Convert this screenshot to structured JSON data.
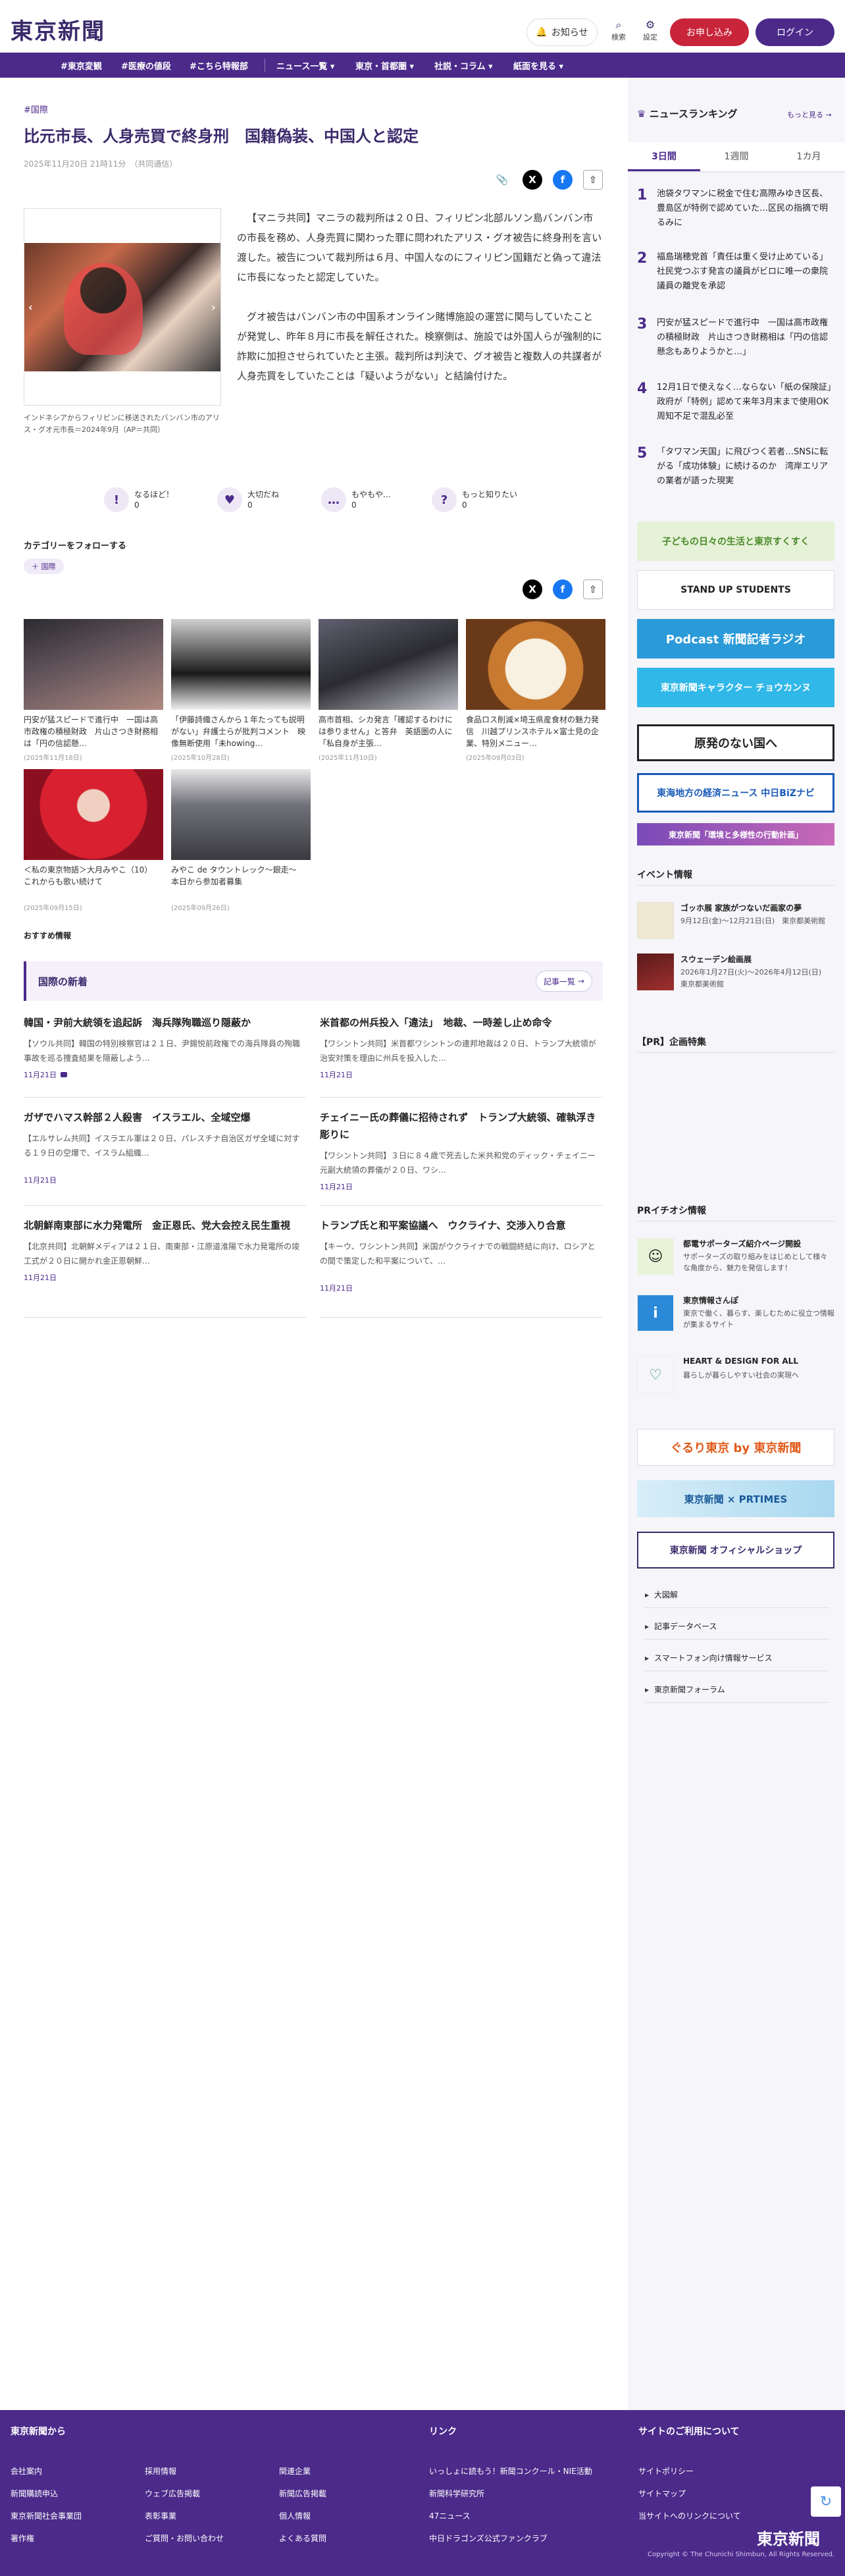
{
  "header": {
    "logo": "東京新聞",
    "notice": "お知らせ",
    "search": "検索",
    "settings": "設定",
    "subscribe": "お申し込み",
    "login": "ログイン"
  },
  "nav": [
    "#東京変観",
    "#医療の値段",
    "#こちら特報部",
    "ニュース一覧",
    "東京・首都圏",
    "社説・コラム",
    "紙面を見る"
  ],
  "article": {
    "category": "#国際",
    "title": "比元市長、人身売買で終身刑　国籍偽装、中国人と認定",
    "date": "2025年11月20日 21時11分　（共同通信）",
    "caption": "インドネシアからフィリピンに移送されたバンバン市のアリス・グオ元市長＝2024年9月（AP＝共同）",
    "paragraphs": [
      "【マニラ共同】マニラの裁判所は２０日、フィリピン北部ルソン島バンバン市の市長を務め、人身売買に関わった罪に問われたアリス・グオ被告に終身刑を言い渡した。被告について裁判所は６月、中国人なのにフィリピン国籍だと偽って違法に市長になったと認定していた。",
      "グオ被告はバンバン市の中国系オンライン賭博施設の運営に関与していたことが発覚し、昨年８月に市長を解任された。検察側は、施設では外国人らが強制的に詐欺に加担させられていたと主張。裁判所は判決で、グオ被告と複数人の共謀者が人身売買をしていたことは「疑いようがない」と結論付けた。"
    ],
    "reactions": [
      {
        "icon": "!",
        "label": "なるほど！",
        "count": "0"
      },
      {
        "icon": "♥",
        "label": "大切だね",
        "count": "0"
      },
      {
        "icon": "…",
        "label": "もやもや…",
        "count": "0"
      },
      {
        "icon": "?",
        "label": "もっと知りたい",
        "count": "0"
      }
    ],
    "follow_label": "カテゴリーをフォローする",
    "follow_tag": "国際"
  },
  "related": [
    {
      "title": "円安が猛スピードで進行中　一国は高市政権の積極財政　片山さつき財務相は「円の信認懸…",
      "date": "(2025年11月18日)",
      "color": "#3a3a40"
    },
    {
      "title": "「伊藤詩織さんから１年たっても説明がない」弁護士らが批判コメント　映像無断使用「未howing…",
      "date": "(2025年10月28日)",
      "color": "#2a2a2a"
    },
    {
      "title": "高市首相、シカ発言「確認するわけには参りません」と答弁　英語圏の人に「私自身が主張…",
      "date": "(2025年11月10日)",
      "color": "#4a4a50"
    },
    {
      "title": "食品ロス削減×埼玉県産食材の魅力発信　川越プリンスホテル×富士見の企業、特別メニュー…",
      "date": "(2025年09月03日)",
      "color": "#8a5a20"
    },
    {
      "title": "＜私の東京物語＞大月みやこ（10）　これからも歌い続けて",
      "date": "(2025年09月15日)",
      "color": "#c8243a"
    },
    {
      "title": "みやこ de タウントレック〜銀走〜　本日から参加者募集",
      "date": "(2025年09月26日)",
      "color": "#555"
    }
  ],
  "recommend_label": "おすすめ情報",
  "intl": {
    "heading": "国際の新着",
    "more": "記事一覧",
    "items": [
      {
        "title": "韓国・尹前大統領を追起訴　海兵隊殉職巡り隠蔽か",
        "summary": "【ソウル共同】韓国の特別検察官は２１日、尹錫悦前政権での海兵隊員の殉職事故を巡る捜査結果を隠蔽しよう…",
        "date": "11月21日"
      },
      {
        "title": "米首都の州兵投入「違法」　地裁、一時差し止め命令",
        "summary": "【ワシントン共同】米首都ワシントンの連邦地裁は２０日、トランプ大統領が治安対策を理由に州兵を投入した…",
        "date": "11月21日"
      },
      {
        "title": "ガザでハマス幹部２人殺害　イスラエル、全域空爆",
        "summary": "【エルサレム共同】イスラエル軍は２０日、パレスチナ自治区ガザ全域に対する１９日の空爆で、イスラム組織…",
        "date": "11月21日"
      },
      {
        "title": "チェイニー氏の葬儀に招待されず　トランプ大統領、確執浮き彫りに",
        "summary": "【ワシントン共同】３日に８４歳で死去した米共和党のディック・チェイニー元副大統領の葬儀が２０日、ワシ…",
        "date": "11月21日"
      },
      {
        "title": "北朝鮮南東部に水力発電所　金正恩氏、党大会控え民生重視",
        "summary": "【北京共同】北朝鮮メディアは２１日、南東部・江原道淮陽で水力発電所の竣工式が２０日に開かれ金正恩朝鮮…",
        "date": "11月21日"
      },
      {
        "title": "トランプ氏と和平案協議へ　ウクライナ、交渉入り合意",
        "summary": "【キーウ、ワシントン共同】米国がウクライナでの戦闘終結に向け、ロシアとの間で策定した和平案について、…",
        "date": "11月21日"
      }
    ]
  },
  "sidebar": {
    "ranking_title": "ニュースランキング",
    "ranking_more": "もっと見る",
    "tabs": [
      "3日間",
      "1週間",
      "1カ月"
    ],
    "ranking": [
      "池袋タワマンに税金で住む高際みゆき区長、豊島区が特例で認めていた…区民の指摘で明るみに",
      "福島瑞穂党首「責任は重く受け止めている」社民党つぶす発言の議員がビロに唯一の衆院議員の離党を承認",
      "円安が猛スピードで進行中　一国は高市政権の積極財政　片山さつき財務相は「円の信認懸念もありようかと…」",
      "12月1日で使えなく…ならない「紙の保険証」政府が「特例」認めて来年3月末まで使用OK　周知不足で混乱必至",
      "「タワマン天国」に飛びつく若者…SNSに転がる「成功体験」に続けるのか　湾岸エリアの業者が語った現実"
    ],
    "banners": [
      "子どもの日々の生活と東京すくすく",
      "STAND UP STUDENTS",
      "Podcast 新聞記者ラジオ",
      "東京新聞キャラクター チョウカンヌ",
      "原発のない国へ",
      "東海地方の経済ニュース 中日BiZナビ",
      "東京新聞「環境と多様性の行動計画」"
    ],
    "events_title": "イベント情報",
    "events": [
      {
        "title": "ゴッホ展 家族がつないだ画家の夢",
        "detail": "9月12日(金)〜12月21日(日)　東京都美術館"
      },
      {
        "title": "スウェーデン絵画展",
        "detail": "2026年1月27日(火)〜2026年4月12日(日)　東京都美術館"
      }
    ],
    "pr_title": "【PR】企画特集",
    "pr_pickup_title": "PRイチオシ情報",
    "pr": [
      {
        "title": "都電サポーターズ紹介ページ開設",
        "detail": "サポーターズの取り組みをはじめとして様々な角度から、魅力を発信します！"
      },
      {
        "title": "東京情報さんぽ",
        "detail": "東京で働く、暮らす、楽しむために役立つ情報が集まるサイト"
      },
      {
        "title": "HEART & DESIGN FOR ALL",
        "detail": "暮らしが暮らしやすい社会の実現へ"
      }
    ],
    "bottom_banners": [
      "ぐるり東京 by 東京新聞",
      "東京新聞 × PRTIMES",
      "東京新聞 オフィシャルショップ"
    ],
    "links": [
      "大図解",
      "記事データベース",
      "スマートフォン向け情報サービス",
      "東京新聞フォーラム"
    ]
  },
  "footer": {
    "col1_title": "東京新聞から",
    "col1": [
      "会社案内",
      "採用情報",
      "関連企業",
      "新聞購読申込",
      "ウェブ広告掲載",
      "新聞広告掲載",
      "東京新聞社会事業団",
      "表彰事業",
      "個人情報",
      "著作権",
      "ご質問・お問い合わせ",
      "よくある質問"
    ],
    "col2_title": "リンク",
    "col2": [
      "いっしょに読もう！新聞コンクール・NIE活動",
      "新聞科学研究所",
      "47ニュース",
      "中日ドラゴンズ公式ファンクラブ"
    ],
    "col3_title": "サイトのご利用について",
    "col3": [
      "サイトポリシー",
      "サイトマップ",
      "当サイトへのリンクについて"
    ],
    "logo": "東京新聞",
    "copyright": "Copyright © The Chunichi Shimbun, All Rights Reserved."
  }
}
